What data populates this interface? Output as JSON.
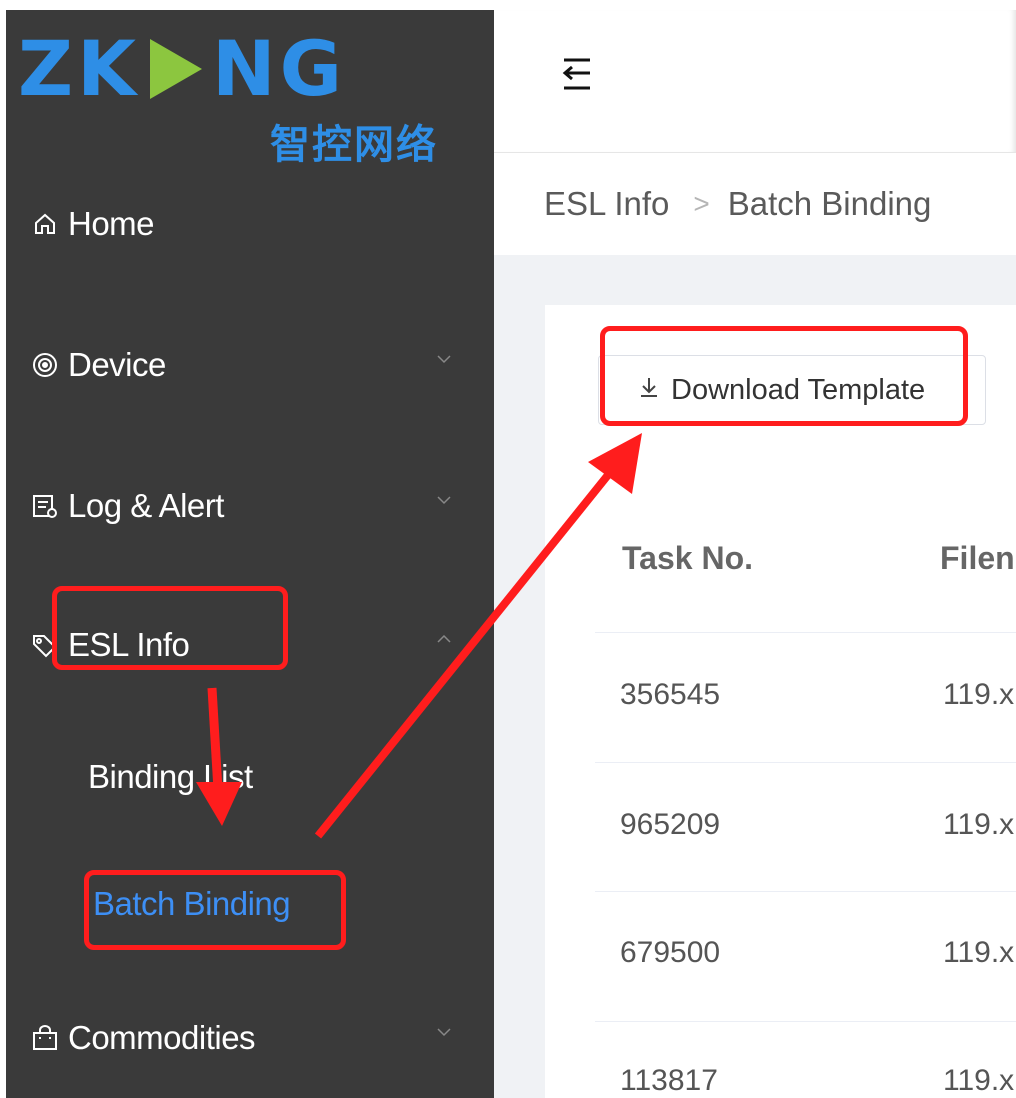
{
  "logo": {
    "text_latin": "ZKDNG",
    "text_cn": "智控网络"
  },
  "sidebar": {
    "items": [
      {
        "label": "Home",
        "icon": "home-icon"
      },
      {
        "label": "Device",
        "icon": "device-icon"
      },
      {
        "label": "Log & Alert",
        "icon": "log-icon"
      },
      {
        "label": "ESL Info",
        "icon": "tag-icon"
      },
      {
        "label": "Commodities",
        "icon": "shopping-bag-icon"
      }
    ],
    "esl_sub_items": [
      {
        "label": "Binding List"
      },
      {
        "label": "Batch Binding",
        "active": true
      }
    ]
  },
  "breadcrumb": {
    "parent": "ESL Info",
    "current": "Batch Binding"
  },
  "toolbar": {
    "download_label": "Download Template"
  },
  "table": {
    "headers": [
      "Task No.",
      "Filen"
    ],
    "rows": [
      [
        "356545",
        "119.x"
      ],
      [
        "965209",
        "119.x"
      ],
      [
        "679500",
        "119.x"
      ],
      [
        "113817",
        "119.x"
      ]
    ]
  },
  "colors": {
    "sidebar_bg": "#3a3a3a",
    "accent": "#3d8ff5",
    "annotation": "#ff1d1d",
    "logo_blue": "#2e8ee6",
    "logo_green": "#8cc63f"
  }
}
